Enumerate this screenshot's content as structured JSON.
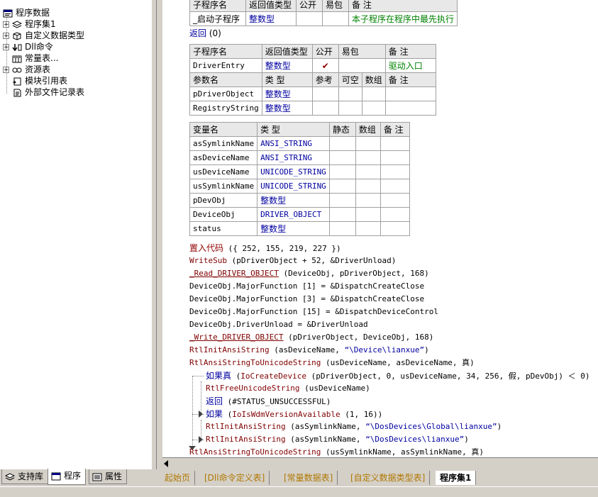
{
  "tree": {
    "root": "程序数据",
    "items": [
      {
        "label": "程序集1",
        "expander": "+"
      },
      {
        "label": "自定义数据类型",
        "expander": "+"
      },
      {
        "label": "Dll命令",
        "expander": "+"
      },
      {
        "label": "常量表...",
        "expander": ""
      },
      {
        "label": "资源表",
        "expander": "+"
      },
      {
        "label": "模块引用表",
        "expander": ""
      },
      {
        "label": "外部文件记录表",
        "expander": ""
      }
    ]
  },
  "left_tabs": [
    {
      "label": "支持库"
    },
    {
      "label": "程序"
    },
    {
      "label": "属性"
    }
  ],
  "top_table": {
    "headers": [
      "子程序名",
      "返回值类型",
      "公开",
      "易包",
      "备 注"
    ],
    "row": [
      "_启动子程序",
      "整数型",
      "",
      "",
      "本子程序在程序中最先执行"
    ]
  },
  "return_line": {
    "kw": "返回",
    "arg": "(0)"
  },
  "sub_table": {
    "headers": [
      "子程序名",
      "返回值类型",
      "公开",
      "易包",
      "备 注"
    ],
    "row": {
      "name": "DriverEntry",
      "type": "整数型",
      "public": "✔",
      "pkg": "",
      "note": "驱动入口"
    },
    "param_headers": [
      "参数名",
      "类 型",
      "参考",
      "可空",
      "数组",
      "备 注"
    ],
    "params": [
      {
        "name": "pDriverObject",
        "type": "整数型"
      },
      {
        "name": "RegistryString",
        "type": "整数型"
      }
    ]
  },
  "var_table": {
    "headers": [
      "变量名",
      "类 型",
      "静态",
      "数组",
      "备 注"
    ],
    "vars": [
      {
        "name": "asSymlinkName",
        "type": "ANSI_STRING"
      },
      {
        "name": "asDeviceName",
        "type": "ANSI_STRING"
      },
      {
        "name": "usDeviceName",
        "type": "UNICODE_STRING"
      },
      {
        "name": "usSymlinkName",
        "type": "UNICODE_STRING"
      },
      {
        "name": "pDevObj",
        "type": "整数型"
      },
      {
        "name": "DeviceObj",
        "type": "DRIVER_OBJECT"
      },
      {
        "name": "status",
        "type": "整数型"
      }
    ]
  },
  "code": {
    "l1_kw": "置入代码",
    "l1_rest": " ({ 252, 155, 219, 227 })",
    "l2_fn": "WriteSub",
    "l2_rest": " (pDriverObject + 52, &DriverUnload)",
    "l3_fn": "_Read_DRIVER_OBJECT",
    "l3_rest": " (DeviceObj, pDriverObject, 168)",
    "l4": "DeviceObj.MajorFunction [1] = &DispatchCreateClose",
    "l5": "DeviceObj.MajorFunction [3] = &DispatchCreateClose",
    "l6": "DeviceObj.MajorFunction [15] = &DispatchDeviceControl",
    "l7": "DeviceObj.DriverUnload = &DriverUnload",
    "l8_fn": "_Write_DRIVER_OBJECT",
    "l8_rest": " (pDriverObject, DeviceObj, 168)",
    "l9_fn": "RtlInitAnsiString",
    "l9_a": " (asDeviceName, ",
    "l9_s": "“\\Device\\lianxue”",
    "l9_b": ")",
    "l10_fn": "RtlAnsiStringToUnicodeString",
    "l10_rest": " (usDeviceName, asDeviceName, 真)",
    "l11_kw": "如果真",
    "l11_a": " (",
    "l11_fn": "IoCreateDevice",
    "l11_b": " (pDriverObject, 0, usDeviceName, 34, 256, 假, pDevObj) ＜ 0)",
    "l12_fn": "RtlFreeUnicodeString",
    "l12_rest": " (usDeviceName)",
    "l13_kw": "返回",
    "l13_rest": " (#STATUS_UNSUCCESSFUL)",
    "l14_kw": "如果",
    "l14_a": " (",
    "l14_fn": "IoIsWdmVersionAvailable",
    "l14_b": " (1, 16))",
    "l15_fn": "RtlInitAnsiString",
    "l15_a": " (asSymlinkName, ",
    "l15_s": "“\\DosDevices\\Global\\lianxue”",
    "l15_b": ")",
    "l16_fn": "RtlInitAnsiString",
    "l16_a": " (asSymlinkName, ",
    "l16_s": "“\\DosDevices\\lianxue”",
    "l16_b": ")",
    "l17_fn": "RtlAnsiStringToUnicodeString",
    "l17_rest": " (usSymlinkName, asSymlinkName, 真)"
  },
  "editor_tabs": [
    {
      "label": "起始页"
    },
    {
      "label": "[Dll命令定义表]"
    },
    {
      "label": "[常量数据表]"
    },
    {
      "label": "[自定义数据类型表]"
    },
    {
      "label": "程序集1"
    }
  ],
  "colors": {
    "keyword": "#900000",
    "type": "#0000a0",
    "comment": "#008000",
    "tab_inactive": "#b07800"
  }
}
